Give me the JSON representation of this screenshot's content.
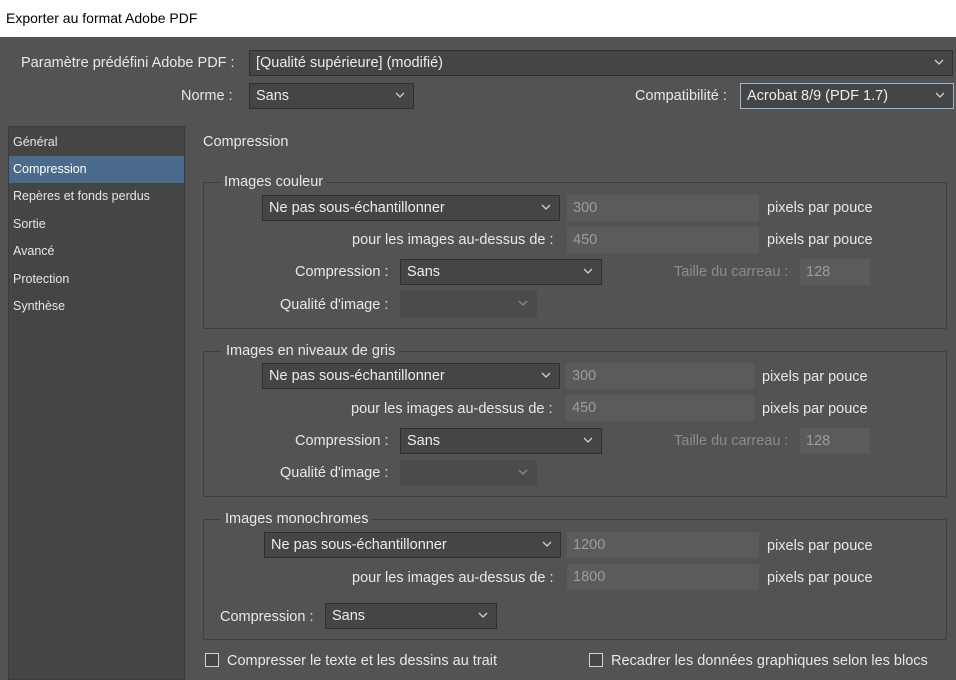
{
  "window": {
    "title": "Exporter au format Adobe PDF"
  },
  "header": {
    "preset_label": "Paramètre prédéfini Adobe PDF :",
    "preset_value": "[Qualité supérieure] (modifié)",
    "standard_label": "Norme :",
    "standard_value": "Sans",
    "compat_label": "Compatibilité :",
    "compat_value": "Acrobat 8/9 (PDF 1.7)"
  },
  "sidebar": {
    "items": [
      {
        "label": "Général"
      },
      {
        "label": "Compression"
      },
      {
        "label": "Repères et fonds perdus"
      },
      {
        "label": "Sortie"
      },
      {
        "label": "Avancé"
      },
      {
        "label": "Protection"
      },
      {
        "label": "Synthèse"
      }
    ],
    "active": "Compression"
  },
  "main": {
    "section_title": "Compression",
    "color": {
      "title": "Images couleur",
      "downsample": "Ne pas sous-échantillonner",
      "ppi": "300",
      "ppi_unit": "pixels par pouce",
      "above_label": "pour les images au-dessus de :",
      "above_value": "450",
      "above_unit": "pixels par pouce",
      "compression_label": "Compression :",
      "compression_value": "Sans",
      "tile_label": "Taille du carreau :",
      "tile_value": "128",
      "quality_label": "Qualité d'image :",
      "quality_value": ""
    },
    "gray": {
      "title": "Images en niveaux de gris",
      "downsample": "Ne pas sous-échantillonner",
      "ppi": "300",
      "ppi_unit": "pixels par pouce",
      "above_label": "pour les images au-dessus de :",
      "above_value": "450",
      "above_unit": "pixels par pouce",
      "compression_label": "Compression :",
      "compression_value": "Sans",
      "tile_label": "Taille du carreau :",
      "tile_value": "128",
      "quality_label": "Qualité d'image :",
      "quality_value": ""
    },
    "mono": {
      "title": "Images monochromes",
      "downsample": "Ne pas sous-échantillonner",
      "ppi": "1200",
      "ppi_unit": "pixels par pouce",
      "above_label": "pour les images au-dessus de :",
      "above_value": "1800",
      "above_unit": "pixels par pouce",
      "compression_label": "Compression :",
      "compression_value": "Sans"
    },
    "compress_text_label": "Compresser le texte et les dessins au trait",
    "compress_text_checked": false,
    "crop_label": "Recadrer les données graphiques selon les blocs",
    "crop_checked": false
  },
  "colors": {
    "accent": "#4b6b8c",
    "background": "#535353",
    "field": "#454545"
  }
}
